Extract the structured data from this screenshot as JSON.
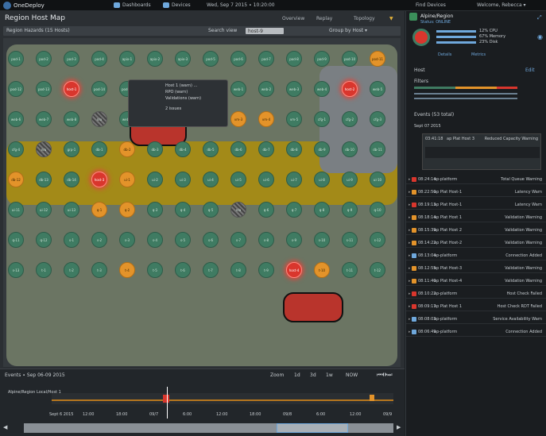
{
  "topbar": {
    "app_name": "OneDeploy",
    "nav": [
      "Dashboards",
      "Devices"
    ],
    "date": "Wed, Sep 7 2015 ∙ 10:20:00",
    "right_nav": [
      "Find Devices",
      "Welcome, Rebecca ▾"
    ]
  },
  "map": {
    "title": "Region Host Map",
    "controls": [
      "Overview",
      "Replay",
      "Topology"
    ],
    "toolbar": {
      "left_label": "Region Hazards (15 Hosts)",
      "search_label": "Search view",
      "search_value": "host-9",
      "right_label": "Group by Host ▾"
    }
  },
  "nodes": [
    {
      "label": "pod-1",
      "state": "ok"
    },
    {
      "label": "pod-2",
      "state": "ok"
    },
    {
      "label": "pod-3",
      "state": "ok"
    },
    {
      "label": "pod-4",
      "state": "ok"
    },
    {
      "label": "apix-1",
      "state": "ok"
    },
    {
      "label": "apix-2",
      "state": "ok"
    },
    {
      "label": "apix-3",
      "state": "ok"
    },
    {
      "label": "pod-5",
      "state": "ok"
    },
    {
      "label": "pod-6",
      "state": "ok"
    },
    {
      "label": "pod-7",
      "state": "ok"
    },
    {
      "label": "pod-8",
      "state": "ok"
    },
    {
      "label": "pod-9",
      "state": "ok"
    },
    {
      "label": "pod-10",
      "state": "ok"
    },
    {
      "label": "pod-11",
      "state": "warn"
    },
    {
      "label": "pod-12",
      "state": "ok"
    },
    {
      "label": "pod-13",
      "state": "ok"
    },
    {
      "label": "host-1",
      "state": "crit"
    },
    {
      "label": "pod-14",
      "state": "ok"
    },
    {
      "label": "pod-15",
      "state": "ok"
    },
    {
      "label": "pod-16",
      "state": "ok"
    },
    {
      "label": "pod-17",
      "state": "warn"
    },
    {
      "label": "proxy-1",
      "state": "ok"
    },
    {
      "label": "web-1",
      "state": "ok"
    },
    {
      "label": "web-2",
      "state": "ok"
    },
    {
      "label": "web-3",
      "state": "ok"
    },
    {
      "label": "web-4",
      "state": "ok"
    },
    {
      "label": "host-2",
      "state": "crit"
    },
    {
      "label": "web-5",
      "state": "ok"
    },
    {
      "label": "web-6",
      "state": "ok"
    },
    {
      "label": "web-7",
      "state": "ok"
    },
    {
      "label": "web-8",
      "state": "ok"
    },
    {
      "label": "n/a",
      "state": "na"
    },
    {
      "label": "web-9",
      "state": "ok"
    },
    {
      "label": "web-10",
      "state": "ok"
    },
    {
      "label": "vm-1",
      "state": "ok"
    },
    {
      "label": "vm-2",
      "state": "warn"
    },
    {
      "label": "vm-3",
      "state": "warn"
    },
    {
      "label": "vm-4",
      "state": "warn"
    },
    {
      "label": "vm-5",
      "state": "ok"
    },
    {
      "label": "cfg-1",
      "state": "ok"
    },
    {
      "label": "cfg-2",
      "state": "ok"
    },
    {
      "label": "cfg-3",
      "state": "ok"
    },
    {
      "label": "cfg-4",
      "state": "ok"
    },
    {
      "label": "n/a",
      "state": "na"
    },
    {
      "label": "grp-1",
      "state": "ok"
    },
    {
      "label": "db-1",
      "state": "ok"
    },
    {
      "label": "db-2",
      "state": "warn"
    },
    {
      "label": "db-3",
      "state": "ok"
    },
    {
      "label": "db-4",
      "state": "ok"
    },
    {
      "label": "db-5",
      "state": "ok"
    },
    {
      "label": "db-6",
      "state": "ok"
    },
    {
      "label": "db-7",
      "state": "ok"
    },
    {
      "label": "db-8",
      "state": "ok"
    },
    {
      "label": "db-9",
      "state": "ok"
    },
    {
      "label": "db-10",
      "state": "ok"
    },
    {
      "label": "db-11",
      "state": "ok"
    },
    {
      "label": "db-12",
      "state": "warn"
    },
    {
      "label": "db-13",
      "state": "ok"
    },
    {
      "label": "db-14",
      "state": "ok"
    },
    {
      "label": "host-3",
      "state": "crit"
    },
    {
      "label": "ui-1",
      "state": "warn"
    },
    {
      "label": "ui-2",
      "state": "ok"
    },
    {
      "label": "ui-3",
      "state": "ok"
    },
    {
      "label": "ui-4",
      "state": "ok"
    },
    {
      "label": "ui-5",
      "state": "ok"
    },
    {
      "label": "ui-6",
      "state": "ok"
    },
    {
      "label": "ui-7",
      "state": "ok"
    },
    {
      "label": "ui-8",
      "state": "ok"
    },
    {
      "label": "ui-9",
      "state": "ok"
    },
    {
      "label": "ui-10",
      "state": "ok"
    },
    {
      "label": "ui-11",
      "state": "ok"
    },
    {
      "label": "ui-12",
      "state": "ok"
    },
    {
      "label": "ui-13",
      "state": "ok"
    },
    {
      "label": "q-1",
      "state": "warn"
    },
    {
      "label": "q-2",
      "state": "warn"
    },
    {
      "label": "q-3",
      "state": "ok"
    },
    {
      "label": "q-4",
      "state": "ok"
    },
    {
      "label": "q-5",
      "state": "ok"
    },
    {
      "label": "n/a",
      "state": "na"
    },
    {
      "label": "q-6",
      "state": "ok"
    },
    {
      "label": "q-7",
      "state": "ok"
    },
    {
      "label": "q-8",
      "state": "ok"
    },
    {
      "label": "q-9",
      "state": "ok"
    },
    {
      "label": "q-10",
      "state": "ok"
    },
    {
      "label": "q-11",
      "state": "ok"
    },
    {
      "label": "q-12",
      "state": "ok"
    },
    {
      "label": "s-1",
      "state": "ok"
    },
    {
      "label": "s-2",
      "state": "ok"
    },
    {
      "label": "s-3",
      "state": "ok"
    },
    {
      "label": "s-4",
      "state": "ok"
    },
    {
      "label": "s-5",
      "state": "ok"
    },
    {
      "label": "s-6",
      "state": "ok"
    },
    {
      "label": "s-7",
      "state": "ok"
    },
    {
      "label": "s-8",
      "state": "ok"
    },
    {
      "label": "s-9",
      "state": "ok"
    },
    {
      "label": "s-10",
      "state": "ok"
    },
    {
      "label": "s-11",
      "state": "ok"
    },
    {
      "label": "s-12",
      "state": "ok"
    },
    {
      "label": "s-13",
      "state": "ok"
    },
    {
      "label": "t-1",
      "state": "ok"
    },
    {
      "label": "t-2",
      "state": "ok"
    },
    {
      "label": "t-3",
      "state": "ok"
    },
    {
      "label": "t-4",
      "state": "warn"
    },
    {
      "label": "t-5",
      "state": "ok"
    },
    {
      "label": "t-6",
      "state": "ok"
    },
    {
      "label": "t-7",
      "state": "ok"
    },
    {
      "label": "t-8",
      "state": "ok"
    },
    {
      "label": "t-9",
      "state": "ok"
    },
    {
      "label": "host-4",
      "state": "crit"
    },
    {
      "label": "t-10",
      "state": "warn"
    },
    {
      "label": "t-11",
      "state": "ok"
    },
    {
      "label": "t-12",
      "state": "ok"
    }
  ],
  "popup": {
    "lines": [
      "Host 1 (warn) ...",
      "RPO (warn)",
      "Validations (warn)",
      "2 issues"
    ]
  },
  "timeline": {
    "title": "Events ∙ Sep 06-09 2015",
    "controls": [
      "Zoom",
      "1d",
      "3d",
      "1w",
      "NOW"
    ],
    "row_label": "Alpine/Region Local/Host 1",
    "axis": [
      "Sept 6 2015",
      "12:00",
      "18:00",
      "09/7",
      "6:00",
      "12:00",
      "18:00",
      "09/8",
      "6:00",
      "12:00",
      "09/9"
    ]
  },
  "right": {
    "host_name": "Alpine/Region",
    "host_sub": "Status: ONLINE",
    "stats": [
      "12% CPU",
      "67% Memory",
      "23% Disk"
    ],
    "links": [
      "Details",
      "Metrics"
    ],
    "section_title": "Host",
    "section_link": "Edit",
    "filters_title": "Filters",
    "events_title": "Events (53 total)",
    "events_date": "Sept 07 2015",
    "events": [
      {
        "time": "03:41:18",
        "host": "ap Plat Host 3",
        "desc": "Reduced Capacity Warning",
        "type": "warn"
      },
      {
        "time": "08:24:14",
        "host": "ap-platform",
        "desc": "Total Queue Warning",
        "type": "crit"
      },
      {
        "time": "08:22:50",
        "host": "ap Plat Host-1",
        "desc": "Latency Warn",
        "type": "warn"
      },
      {
        "time": "08:19:13",
        "host": "ap Plat Host-1",
        "desc": "Latency Warn",
        "type": "crit"
      },
      {
        "time": "08:18:14",
        "host": "ap Plat Host 1",
        "desc": "Validation Warning",
        "type": "warn"
      },
      {
        "time": "08:15:39",
        "host": "ap Plat Host 2",
        "desc": "Validation Warning",
        "type": "warn"
      },
      {
        "time": "08:14:22",
        "host": "ap Plat Host-2",
        "desc": "Validation Warning",
        "type": "warn"
      },
      {
        "time": "08:13:04",
        "host": "ap-platform",
        "desc": "Connection Added",
        "type": "info"
      },
      {
        "time": "08:12:55",
        "host": "ap Plat Host-3",
        "desc": "Validation Warning",
        "type": "warn"
      },
      {
        "time": "08:11:40",
        "host": "ap Plat Host-4",
        "desc": "Validation Warning",
        "type": "warn"
      },
      {
        "time": "08:10:22",
        "host": "ap-platform",
        "desc": "Host Check Failed",
        "type": "crit"
      },
      {
        "time": "08:09:17",
        "host": "ap Plat Host 1",
        "desc": "Host Check RDT Failed",
        "type": "crit"
      },
      {
        "time": "08:08:03",
        "host": "ap-platform",
        "desc": "Service Availability Warn",
        "type": "info"
      },
      {
        "time": "08:06:49",
        "host": "ap-platform",
        "desc": "Connection Added",
        "type": "info"
      }
    ]
  },
  "colors": {
    "ok": "#3f7b62",
    "warn": "#e3932a",
    "crit": "#d9362d",
    "accent": "#6fa8dc"
  }
}
